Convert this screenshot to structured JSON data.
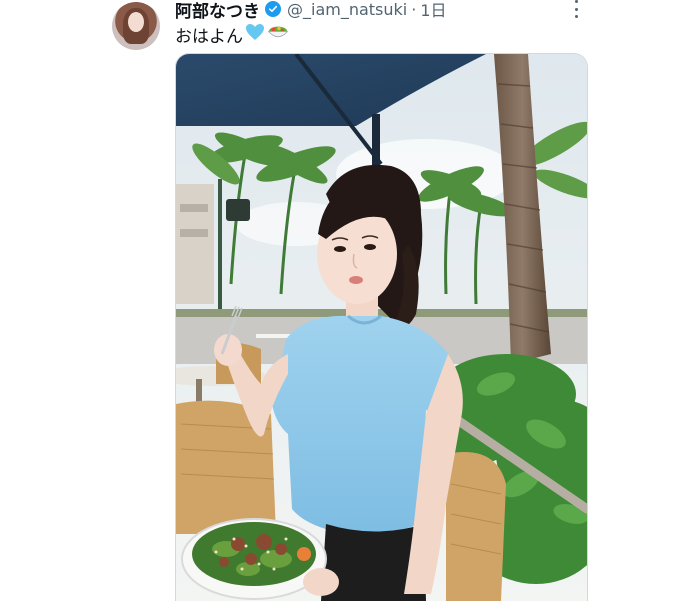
{
  "tweet": {
    "display_name": "阿部なつき",
    "handle": "@_iam_natsuki",
    "separator": "·",
    "timestamp": "1日",
    "text": "おはよん",
    "verified": true,
    "colors": {
      "verified_badge": "#1d9bf0",
      "name": "#0f1419",
      "meta": "#536471"
    }
  },
  "icons": {
    "verified": "verified-badge-icon",
    "more": "more-dots-icon",
    "heart": "light-blue-heart-emoji",
    "salad": "salad-bowl-emoji"
  }
}
